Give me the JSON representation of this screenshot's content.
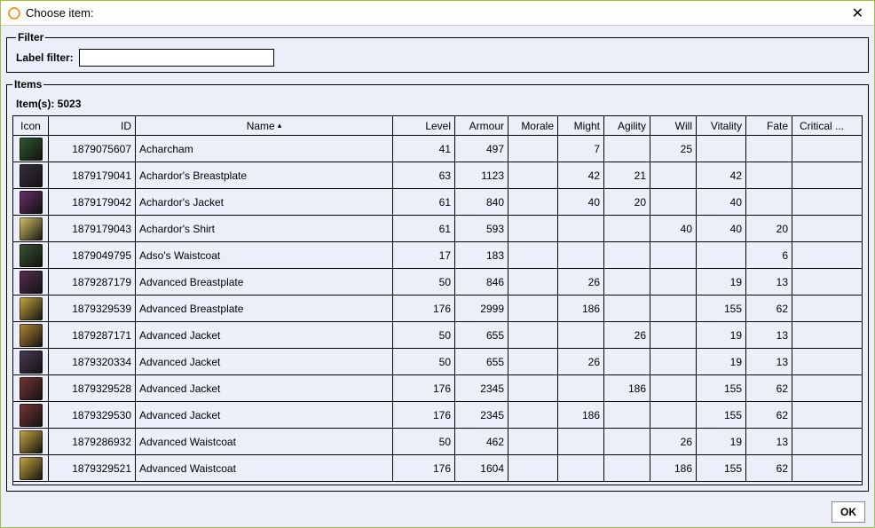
{
  "window": {
    "title": "Choose item:"
  },
  "filter": {
    "legend": "Filter",
    "label": "Label filter:",
    "value": ""
  },
  "items": {
    "legend": "Items",
    "count_label": "Item(s): 5023",
    "columns": {
      "icon": "Icon",
      "id": "ID",
      "name": "Name",
      "level": "Level",
      "armour": "Armour",
      "morale": "Morale",
      "might": "Might",
      "agility": "Agility",
      "will": "Will",
      "vitality": "Vitality",
      "fate": "Fate",
      "critical": "Critical ..."
    },
    "sort_indicator": "▴",
    "rows": [
      {
        "icon_color": "#2f5a2f",
        "id": "1879075607",
        "name": "Acharcham",
        "level": "41",
        "armour": "497",
        "morale": "",
        "might": "7",
        "agility": "",
        "will": "25",
        "vitality": "",
        "fate": "",
        "critical": ""
      },
      {
        "icon_color": "#3a2f40",
        "id": "1879179041",
        "name": "Achardor's Breastplate",
        "level": "63",
        "armour": "1123",
        "morale": "",
        "might": "42",
        "agility": "21",
        "will": "",
        "vitality": "42",
        "fate": "",
        "critical": ""
      },
      {
        "icon_color": "#6a2f6a",
        "id": "1879179042",
        "name": "Achardor's Jacket",
        "level": "61",
        "armour": "840",
        "morale": "",
        "might": "40",
        "agility": "20",
        "will": "",
        "vitality": "40",
        "fate": "",
        "critical": ""
      },
      {
        "icon_color": "#d8c46a",
        "id": "1879179043",
        "name": "Achardor's Shirt",
        "level": "61",
        "armour": "593",
        "morale": "",
        "might": "",
        "agility": "",
        "will": "40",
        "vitality": "40",
        "fate": "20",
        "critical": ""
      },
      {
        "icon_color": "#3a5530",
        "id": "1879049795",
        "name": "Adso's Waistcoat",
        "level": "17",
        "armour": "183",
        "morale": "",
        "might": "",
        "agility": "",
        "will": "",
        "vitality": "",
        "fate": "6",
        "critical": ""
      },
      {
        "icon_color": "#5a2f55",
        "id": "1879287179",
        "name": "Advanced Breastplate",
        "level": "50",
        "armour": "846",
        "morale": "",
        "might": "26",
        "agility": "",
        "will": "",
        "vitality": "19",
        "fate": "13",
        "critical": ""
      },
      {
        "icon_color": "#c8a840",
        "id": "1879329539",
        "name": "Advanced Breastplate",
        "level": "176",
        "armour": "2999",
        "morale": "",
        "might": "186",
        "agility": "",
        "will": "",
        "vitality": "155",
        "fate": "62",
        "critical": ""
      },
      {
        "icon_color": "#b58838",
        "id": "1879287171",
        "name": "Advanced Jacket",
        "level": "50",
        "armour": "655",
        "morale": "",
        "might": "",
        "agility": "26",
        "will": "",
        "vitality": "19",
        "fate": "13",
        "critical": ""
      },
      {
        "icon_color": "#4a3a55",
        "id": "1879320334",
        "name": "Advanced Jacket",
        "level": "50",
        "armour": "655",
        "morale": "",
        "might": "26",
        "agility": "",
        "will": "",
        "vitality": "19",
        "fate": "13",
        "critical": ""
      },
      {
        "icon_color": "#7a3535",
        "id": "1879329528",
        "name": "Advanced Jacket",
        "level": "176",
        "armour": "2345",
        "morale": "",
        "might": "",
        "agility": "186",
        "will": "",
        "vitality": "155",
        "fate": "62",
        "critical": ""
      },
      {
        "icon_color": "#7a3535",
        "id": "1879329530",
        "name": "Advanced Jacket",
        "level": "176",
        "armour": "2345",
        "morale": "",
        "might": "186",
        "agility": "",
        "will": "",
        "vitality": "155",
        "fate": "62",
        "critical": ""
      },
      {
        "icon_color": "#c8a840",
        "id": "1879286932",
        "name": "Advanced Waistcoat",
        "level": "50",
        "armour": "462",
        "morale": "",
        "might": "",
        "agility": "",
        "will": "26",
        "vitality": "19",
        "fate": "13",
        "critical": ""
      },
      {
        "icon_color": "#c8a840",
        "id": "1879329521",
        "name": "Advanced Waistcoat",
        "level": "176",
        "armour": "1604",
        "morale": "",
        "might": "",
        "agility": "",
        "will": "186",
        "vitality": "155",
        "fate": "62",
        "critical": ""
      }
    ]
  },
  "footer": {
    "ok_label": "OK"
  }
}
